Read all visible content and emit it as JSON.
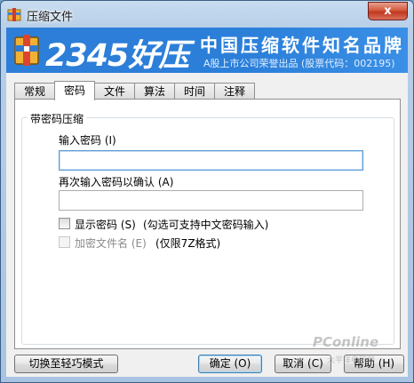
{
  "window": {
    "title": "压缩文件",
    "close_symbol": "x"
  },
  "banner": {
    "logo": "2345好压",
    "slogan": "中国压缩软件知名品牌",
    "company": "A股上市公司荣誉出品 (股票代码：002195)"
  },
  "tabs": [
    {
      "label": "常规"
    },
    {
      "label": "密码"
    },
    {
      "label": "文件"
    },
    {
      "label": "算法"
    },
    {
      "label": "时间"
    },
    {
      "label": "注释"
    }
  ],
  "active_tab": "密码",
  "group": {
    "title": "带密码压缩"
  },
  "password": {
    "label": "输入密码 (I)",
    "value": ""
  },
  "confirm_password": {
    "label": "再次输入密码以确认 (A)",
    "value": ""
  },
  "show_password": {
    "label": "显示密码 (S)",
    "note": "(勾选可支持中文密码输入)",
    "checked": false
  },
  "encrypt_filenames": {
    "label": "加密文件名 (E)",
    "note": "(仅限7Z格式)",
    "checked": false,
    "enabled": false
  },
  "buttons": {
    "switch_mode": "切换至轻巧模式",
    "ok": "确定 (O)",
    "cancel": "取消 (C)",
    "help": "帮助 (H)"
  },
  "watermark": {
    "brand": "PConline",
    "site": "太平洋电脑网"
  },
  "colors": {
    "banner_blue": "#2b7fd9",
    "close_red": "#c9432b"
  }
}
